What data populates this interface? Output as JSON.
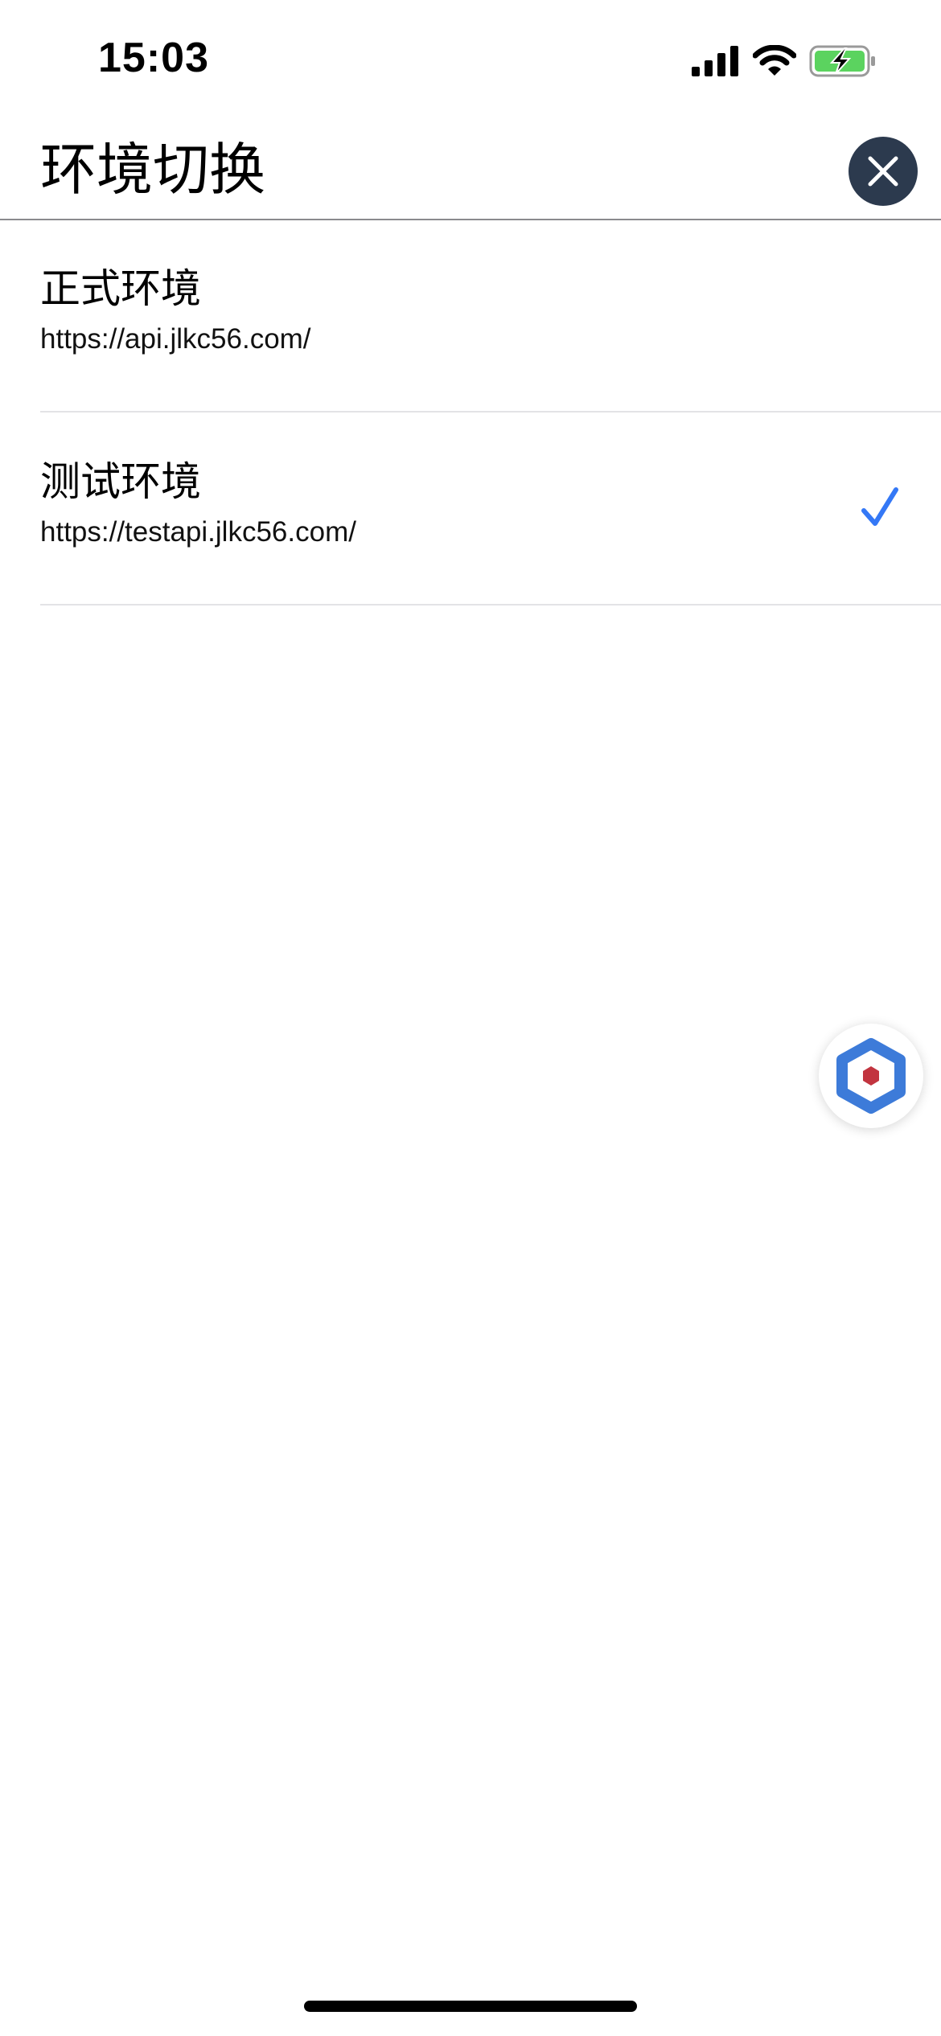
{
  "status_bar": {
    "time": "15:03",
    "icons": [
      "cellular-signal-icon",
      "wifi-icon",
      "battery-charging-icon"
    ],
    "battery_color": "#5bd35f"
  },
  "header": {
    "title": "环境切换",
    "close_icon": "close-icon"
  },
  "environments": [
    {
      "name": "正式环境",
      "url": "https://api.jlkc56.com/",
      "selected": false
    },
    {
      "name": "测试环境",
      "url": "https://testapi.jlkc56.com/",
      "selected": true
    }
  ],
  "floating_button": {
    "icon": "debug-hexagon-icon",
    "colors": {
      "outer": "#3d7bd9",
      "inner": "#c2343f"
    }
  },
  "colors": {
    "accent": "#3478f6",
    "close_button_bg": "#2c3a4e",
    "divider": "#e3e3e6"
  }
}
